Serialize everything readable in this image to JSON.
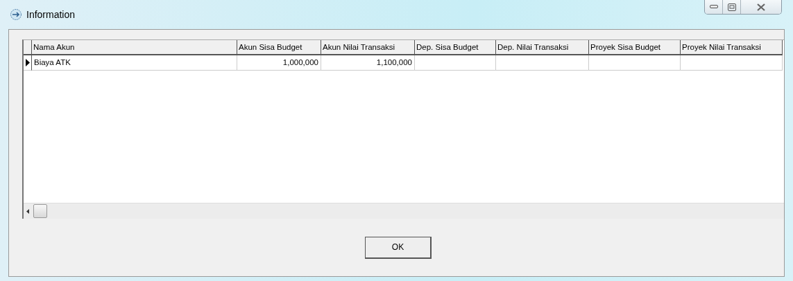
{
  "window": {
    "title": "Information"
  },
  "table": {
    "columns": [
      "Nama Akun",
      "Akun Sisa Budget",
      "Akun Nilai Transaksi",
      "Dep. Sisa Budget",
      "Dep. Nilai Transaksi",
      "Proyek Sisa Budget",
      "Proyek Nilai Transaksi"
    ],
    "rows": [
      {
        "selected": true,
        "cells": [
          "Biaya ATK",
          "1,000,000",
          "1,100,000",
          "",
          "",
          "",
          ""
        ]
      }
    ]
  },
  "buttons": [
    "OK"
  ]
}
